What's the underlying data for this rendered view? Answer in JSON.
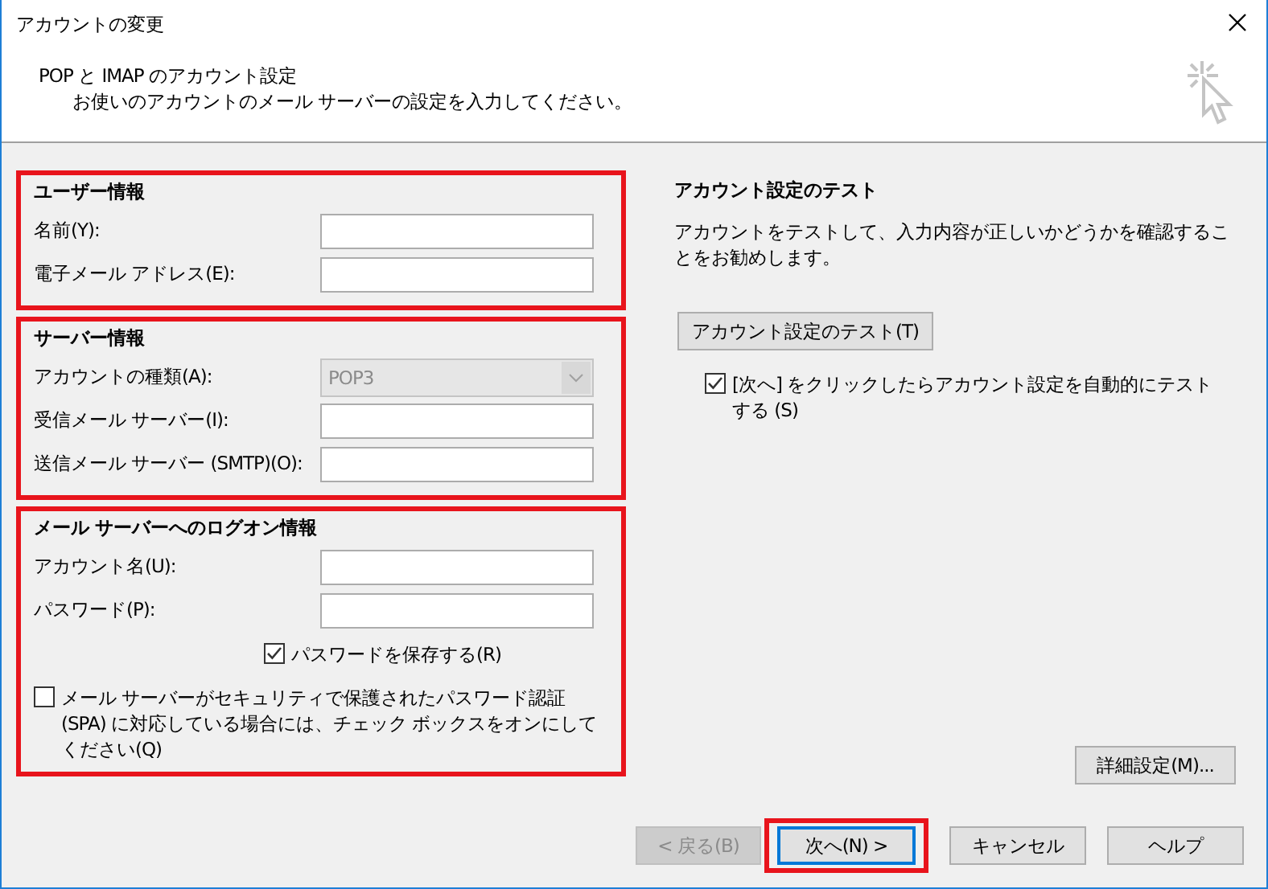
{
  "window": {
    "title": "アカウントの変更"
  },
  "header": {
    "title": "POP と IMAP のアカウント設定",
    "subtitle": "お使いのアカウントのメール サーバーの設定を入力してください。"
  },
  "sections": [
    {
      "title": "ユーザー情報",
      "highlighted": true,
      "rows": [
        {
          "kind": "text",
          "label": "名前(Y):"
        },
        {
          "kind": "text",
          "label": "電子メール アドレス(E):"
        }
      ]
    },
    {
      "title": "サーバー情報",
      "highlighted": true,
      "rows": [
        {
          "kind": "dropdown",
          "label": "アカウントの種類(A):",
          "value": "POP3",
          "disabled": true
        },
        {
          "kind": "text",
          "label": "受信メール サーバー(I):"
        },
        {
          "kind": "text",
          "label": "送信メール サーバー (SMTP)(O):"
        }
      ]
    },
    {
      "title": "メール サーバーへのログオン情報",
      "highlighted": true,
      "rows": [
        {
          "kind": "text",
          "label": "アカウント名(U):"
        },
        {
          "kind": "text",
          "label": "パスワード(P):"
        },
        {
          "kind": "checkbox",
          "label": "パスワードを保存する(R)",
          "checked": true
        },
        {
          "kind": "wide_checkbox",
          "label": "メール サーバーがセキュリティで保護されたパスワード認証 (SPA) に対応している場合には、チェック ボックスをオンにしてください(Q)",
          "checked": false
        }
      ]
    }
  ],
  "test_panel": {
    "title": "アカウント設定のテスト",
    "description": "アカウントをテストして、入力内容が正しいかどうかを確認することをお勧めします。",
    "button": "アカウント設定のテスト(T)",
    "auto_test": {
      "label": "[次へ] をクリックしたらアカウント設定を自動的にテストする (S)",
      "checked": true
    }
  },
  "advanced_button": "詳細設定(M)...",
  "footer_buttons": [
    {
      "label": "< 戻る(B)",
      "disabled": true,
      "default": false,
      "highlighted": false
    },
    {
      "label": "次へ(N) >",
      "disabled": false,
      "default": true,
      "highlighted": true
    },
    {
      "label": "キャンセル",
      "disabled": false,
      "default": false,
      "highlighted": false
    },
    {
      "label": "ヘルプ",
      "disabled": false,
      "default": false,
      "highlighted": false
    }
  ]
}
